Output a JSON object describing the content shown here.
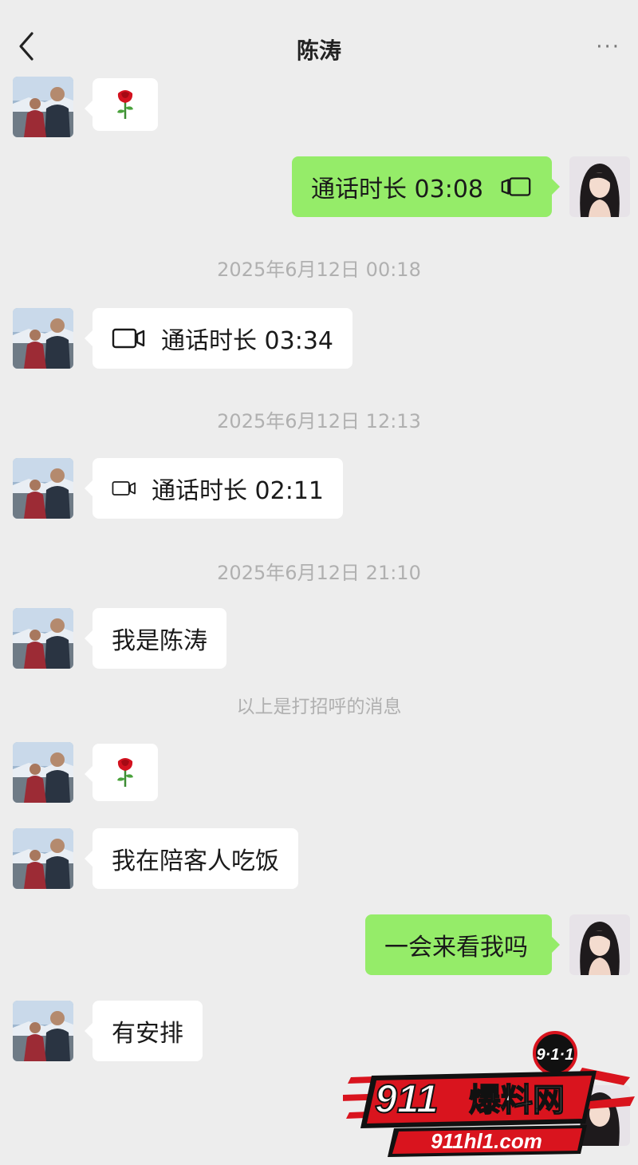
{
  "header": {
    "title": "陈涛",
    "more": "···"
  },
  "messages": [
    {
      "side": "in",
      "type": "emoji",
      "emoji": "rose"
    },
    {
      "side": "out",
      "type": "call",
      "text": "通话时长 03:08"
    },
    {
      "side": "system",
      "type": "timestamp",
      "text": "2025年6月12日 00:18"
    },
    {
      "side": "in",
      "type": "call",
      "text": "通话时长 03:34"
    },
    {
      "side": "system",
      "type": "timestamp",
      "text": "2025年6月12日 12:13"
    },
    {
      "side": "in",
      "type": "call",
      "text": "通话时长 02:11"
    },
    {
      "side": "system",
      "type": "timestamp",
      "text": "2025年6月12日 21:10"
    },
    {
      "side": "in",
      "type": "text",
      "text": "我是陈涛"
    },
    {
      "side": "system",
      "type": "note",
      "text": "以上是打招呼的消息"
    },
    {
      "side": "in",
      "type": "emoji",
      "emoji": "rose"
    },
    {
      "side": "in",
      "type": "text",
      "text": "我在陪客人吃饭"
    },
    {
      "side": "out",
      "type": "text",
      "text": "一会来看我吗"
    },
    {
      "side": "in",
      "type": "text",
      "text": "有安排"
    }
  ],
  "watermark": {
    "badge": "9·1·1",
    "brand_number": "911",
    "brand_text": "爆料网",
    "url": "911hl1.com"
  },
  "colors": {
    "background": "#ededed",
    "incoming_bubble": "#ffffff",
    "outgoing_bubble": "#95ec69",
    "timestamp": "#b0b0b0",
    "watermark_red": "#d9141e"
  }
}
